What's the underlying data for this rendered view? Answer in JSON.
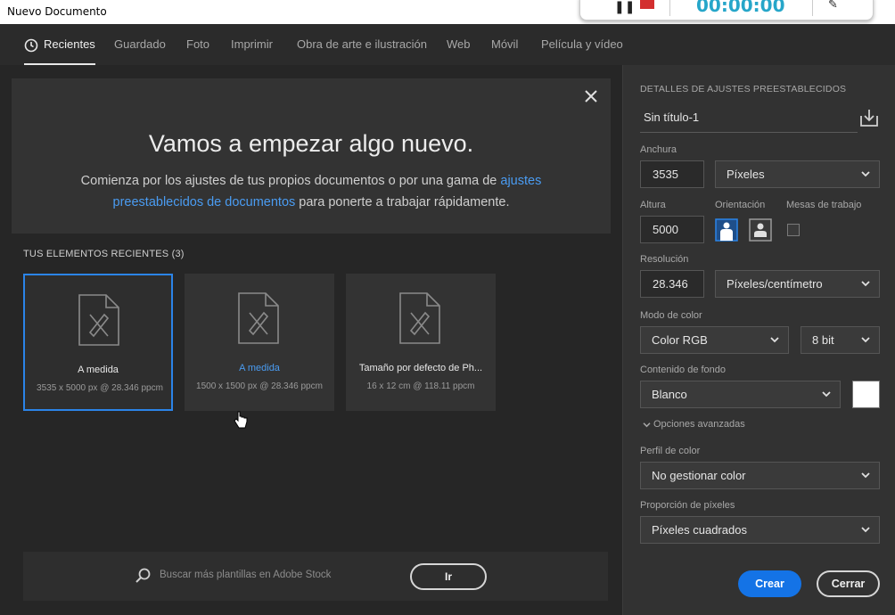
{
  "window": {
    "title": "Nuevo Documento"
  },
  "recorder": {
    "time": "00:00:00"
  },
  "tabs": [
    "Recientes",
    "Guardado",
    "Foto",
    "Imprimir",
    "Obra de arte e ilustración",
    "Web",
    "Móvil",
    "Película y vídeo"
  ],
  "hero": {
    "heading": "Vamos a empezar algo nuevo.",
    "text_before": "Comienza por los ajustes de tus propios documentos o por una gama de ",
    "link": "ajustes preestablecidos de documentos",
    "text_after": " para ponerte a trabajar rápidamente."
  },
  "recent": {
    "heading": "TUS ELEMENTOS RECIENTES",
    "count": "(3)",
    "items": [
      {
        "name": "A medida",
        "meta": "3535 x 5000 px @ 28.346 ppcm"
      },
      {
        "name": "A medida",
        "meta": "1500 x 1500 px @ 28.346 ppcm"
      },
      {
        "name": "Tamaño por defecto de Ph...",
        "meta": "16 x 12 cm @ 118.11 ppcm"
      }
    ]
  },
  "search": {
    "placeholder": "Buscar más plantillas en Adobe Stock",
    "go": "Ir"
  },
  "details": {
    "title": "DETALLES DE AJUSTES PREESTABLECIDOS",
    "doc_name": "Sin título-1",
    "width_label": "Anchura",
    "width_value": "3535",
    "width_unit": "Píxeles",
    "height_label": "Altura",
    "height_value": "5000",
    "orientation_label": "Orientación",
    "artboards_label": "Mesas de trabajo",
    "resolution_label": "Resolución",
    "resolution_value": "28.346",
    "resolution_unit": "Píxeles/centímetro",
    "color_mode_label": "Modo de color",
    "color_mode": "Color RGB",
    "bit_depth": "8 bit",
    "background_label": "Contenido de fondo",
    "background": "Blanco",
    "background_color": "#ffffff",
    "advanced": "Opciones avanzadas",
    "profile_label": "Perfil de color",
    "profile": "No gestionar color",
    "pixel_ratio_label": "Proporción de píxeles",
    "pixel_ratio": "Píxeles cuadrados",
    "create": "Crear",
    "cancel": "Cerrar"
  },
  "colors": {
    "accent": "#1473e6",
    "link": "#4a9cf2"
  }
}
